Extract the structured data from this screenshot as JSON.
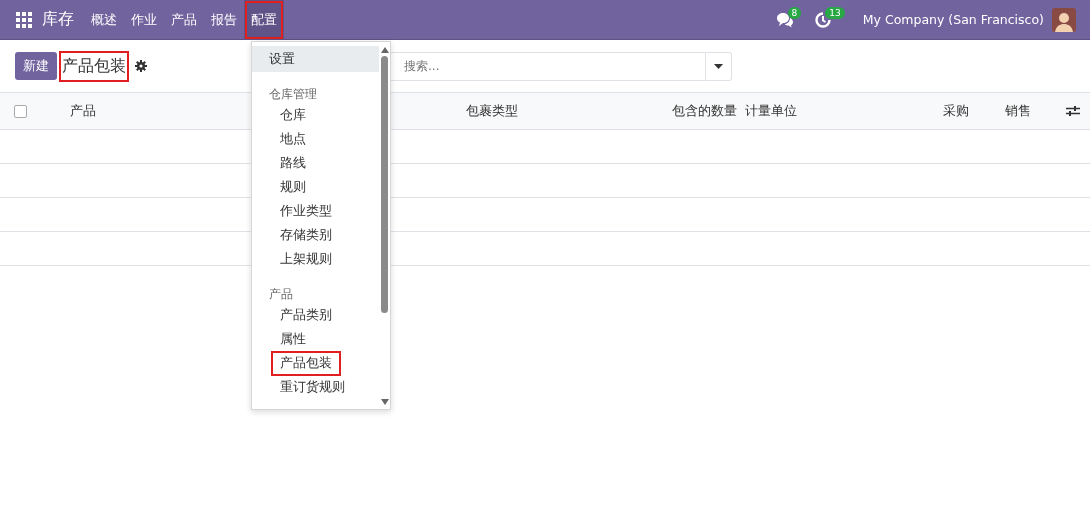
{
  "navbar": {
    "app_title": "库存",
    "menus": [
      {
        "label": "概述",
        "highlighted": false
      },
      {
        "label": "作业",
        "highlighted": false
      },
      {
        "label": "产品",
        "highlighted": false
      },
      {
        "label": "报告",
        "highlighted": false
      },
      {
        "label": "配置",
        "highlighted": true
      }
    ],
    "messages_badge": "8",
    "activities_badge": "13",
    "company": "My Company (San Francisco)"
  },
  "control_panel": {
    "new_button": "新建",
    "title": "产品包装",
    "title_highlighted": true,
    "search": {
      "placeholder": "搜索..."
    }
  },
  "table": {
    "columns": [
      "产品",
      "包裹类型",
      "包含的数量",
      "计量单位",
      "采购",
      "销售"
    ],
    "select_all_checked": false
  },
  "dropdown": {
    "items": [
      {
        "kind": "top",
        "label": "设置",
        "selected": true,
        "highlighted": false
      },
      {
        "kind": "header",
        "label": "仓库管理",
        "selected": false,
        "highlighted": false
      },
      {
        "kind": "item",
        "label": "仓库",
        "selected": false,
        "highlighted": false
      },
      {
        "kind": "item",
        "label": "地点",
        "selected": false,
        "highlighted": false
      },
      {
        "kind": "item",
        "label": "路线",
        "selected": false,
        "highlighted": false
      },
      {
        "kind": "item",
        "label": "规则",
        "selected": false,
        "highlighted": false
      },
      {
        "kind": "item",
        "label": "作业类型",
        "selected": false,
        "highlighted": false
      },
      {
        "kind": "item",
        "label": "存储类别",
        "selected": false,
        "highlighted": false
      },
      {
        "kind": "item",
        "label": "上架规则",
        "selected": false,
        "highlighted": false
      },
      {
        "kind": "header",
        "label": "产品",
        "selected": false,
        "highlighted": false
      },
      {
        "kind": "item",
        "label": "产品类别",
        "selected": false,
        "highlighted": false
      },
      {
        "kind": "item",
        "label": "属性",
        "selected": false,
        "highlighted": false
      },
      {
        "kind": "item",
        "label": "产品包装",
        "selected": false,
        "highlighted": true
      },
      {
        "kind": "item",
        "label": "重订货规则",
        "selected": false,
        "highlighted": false
      }
    ]
  }
}
